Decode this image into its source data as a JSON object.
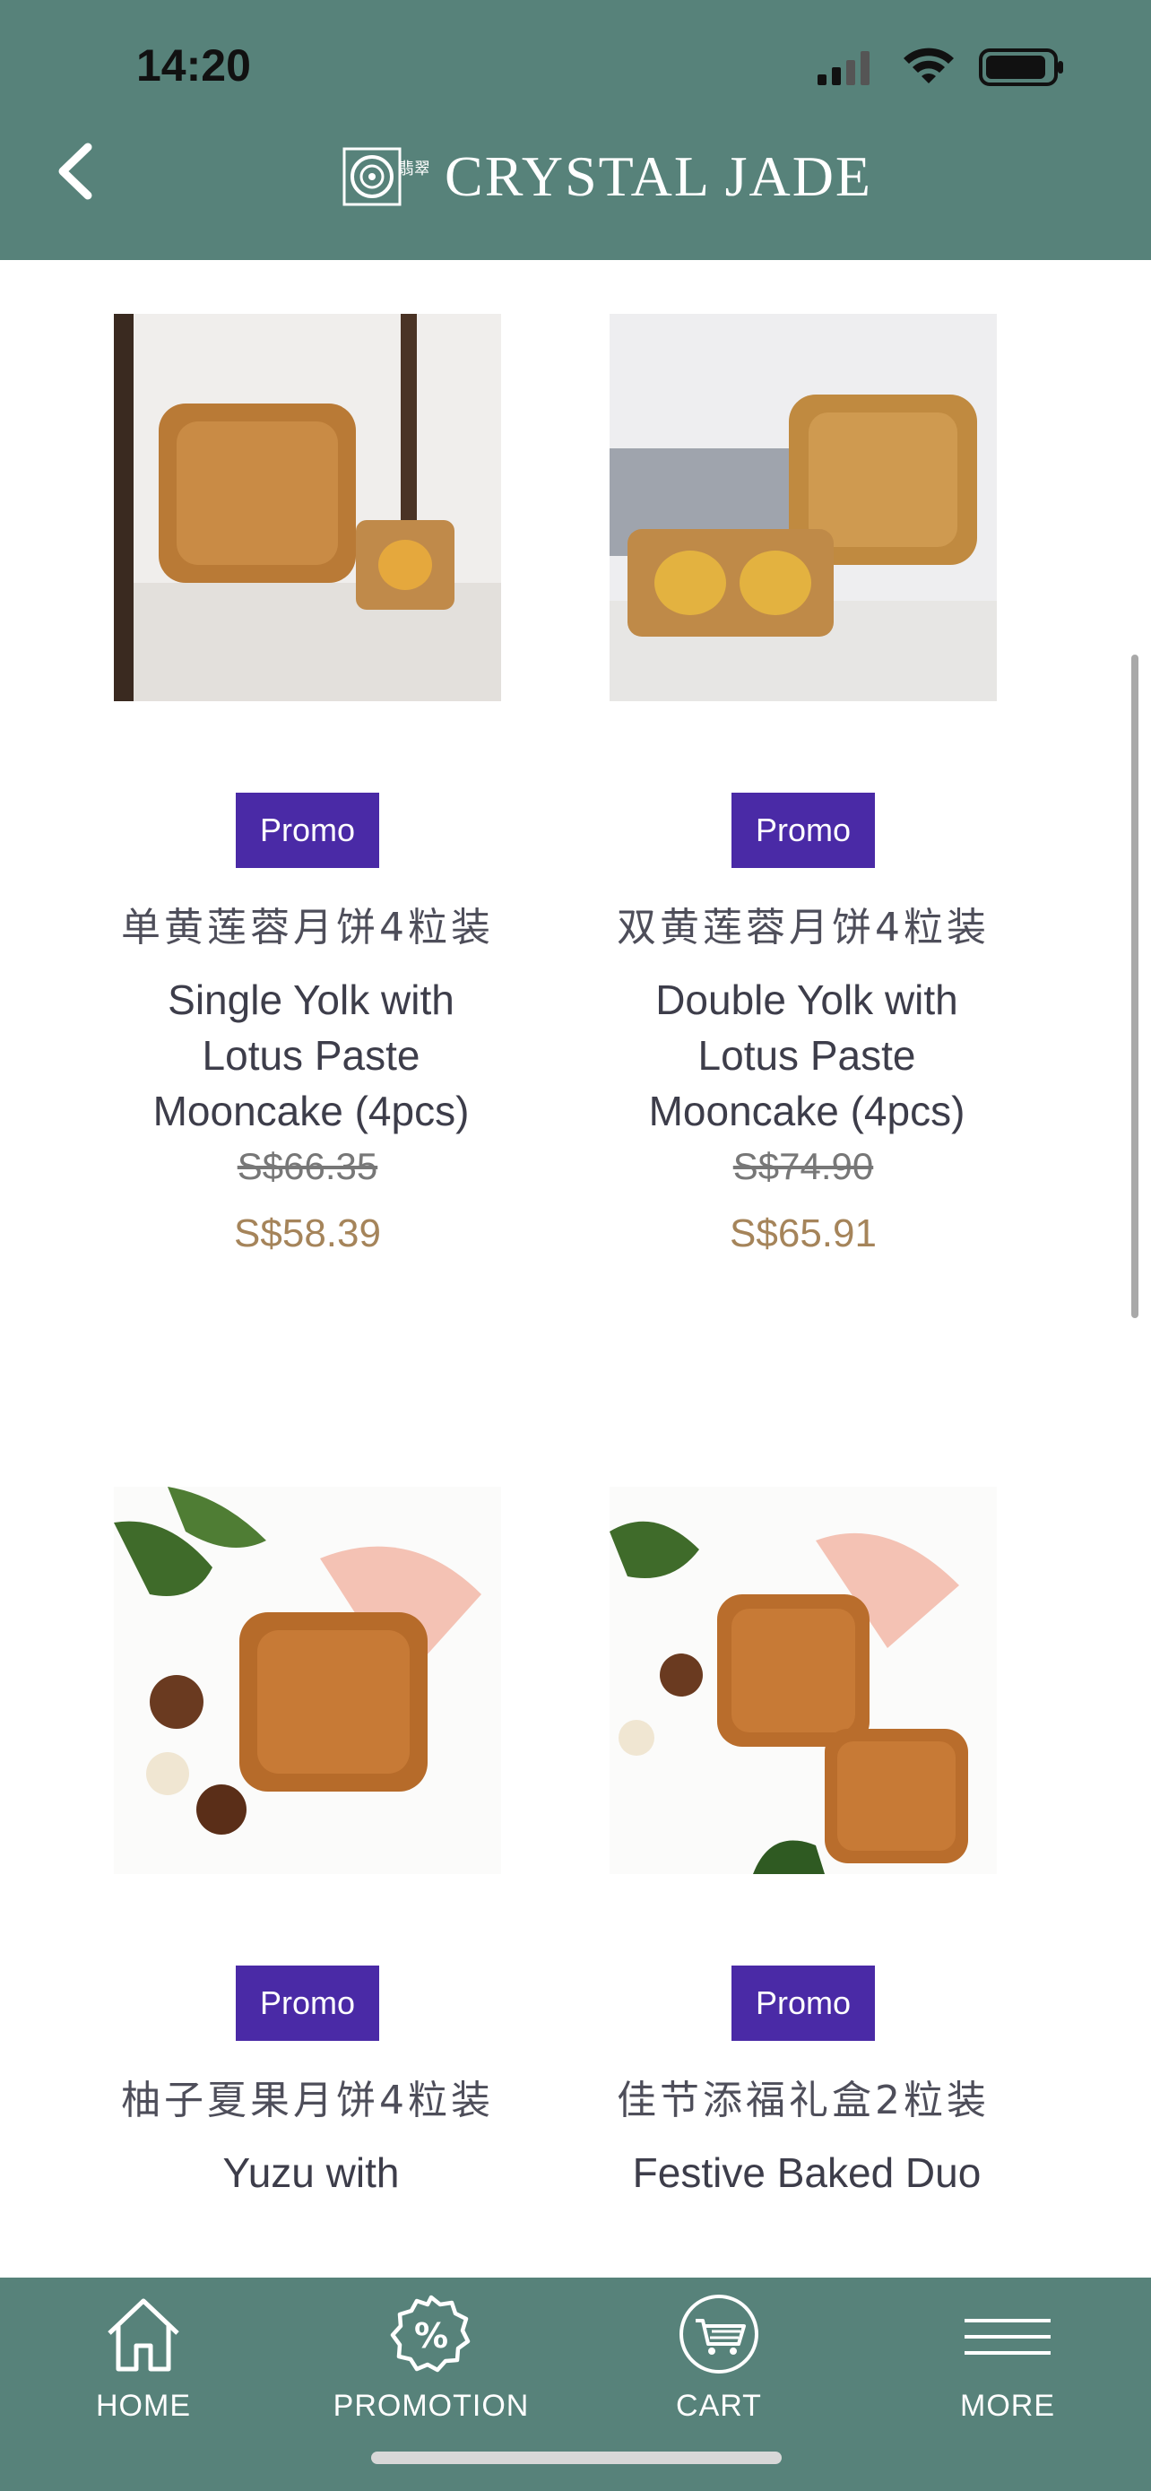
{
  "status_bar": {
    "time": "14:20"
  },
  "header": {
    "brand": "CRYSTAL JADE",
    "brand_seal": "翡翠"
  },
  "products": [
    {
      "badge": "Promo",
      "name_cn": "单黄莲蓉月饼4粒装",
      "name_en": "Single Yolk with Lotus Paste Mooncake (4pcs)",
      "original_price": "S$66.35",
      "price": "S$58.39",
      "image_alt": "single yolk mooncake"
    },
    {
      "badge": "Promo",
      "name_cn": "双黄莲蓉月饼4粒装",
      "name_en": "Double Yolk with Lotus Paste Mooncake (4pcs)",
      "original_price": "S$74.90",
      "price": "S$65.91",
      "image_alt": "double yolk mooncake"
    },
    {
      "badge": "Promo",
      "name_cn": "柚子夏果月饼4粒装",
      "name_en": "Yuzu with",
      "image_alt": "yuzu mooncake"
    },
    {
      "badge": "Promo",
      "name_cn": "佳节添福礼盒2粒装",
      "name_en": "Festive Baked Duo",
      "image_alt": "festive baked duo mooncakes"
    }
  ],
  "tabbar": {
    "home": "HOME",
    "promotion": "PROMOTION",
    "cart": "CART",
    "more": "MORE"
  },
  "colors": {
    "header_bg": "#57827a",
    "promo_badge": "#4a2aa6",
    "price": "#a5845a"
  }
}
